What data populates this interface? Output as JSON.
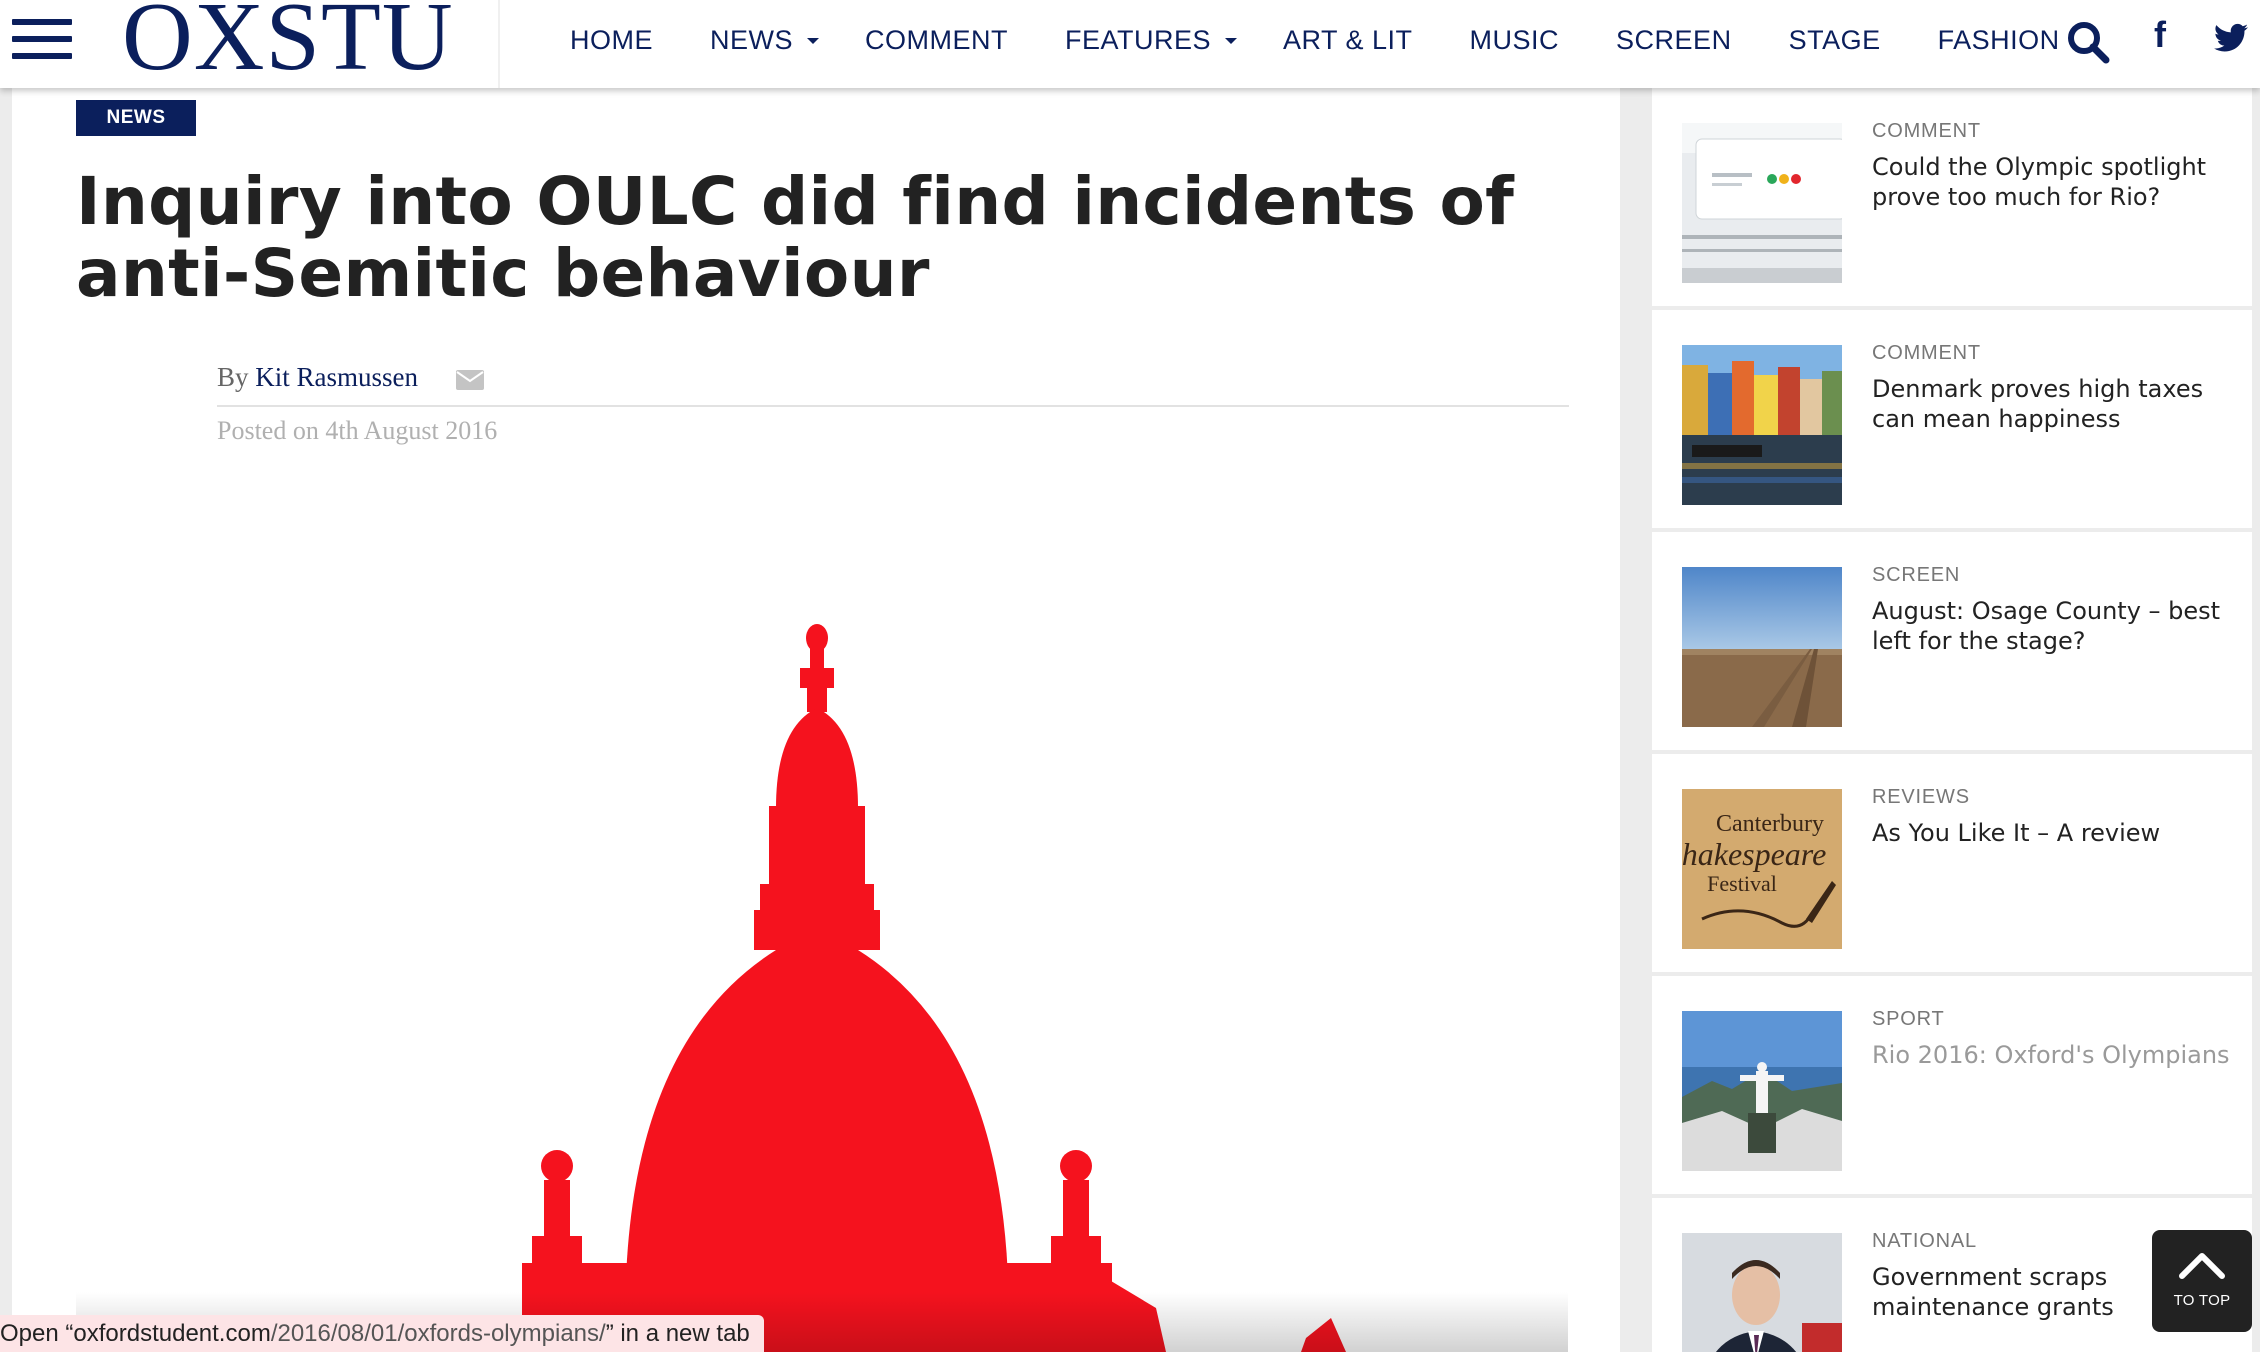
{
  "header": {
    "logo": "OXSTU",
    "nav": [
      {
        "label": "HOME",
        "dropdown": false
      },
      {
        "label": "NEWS",
        "dropdown": true
      },
      {
        "label": "COMMENT",
        "dropdown": false
      },
      {
        "label": "FEATURES",
        "dropdown": true
      },
      {
        "label": "ART & LIT",
        "dropdown": false
      },
      {
        "label": "MUSIC",
        "dropdown": false
      },
      {
        "label": "SCREEN",
        "dropdown": false
      },
      {
        "label": "STAGE",
        "dropdown": false
      },
      {
        "label": "FASHION",
        "dropdown": false
      }
    ],
    "icons": [
      "menu-icon",
      "search-icon",
      "facebook-icon",
      "twitter-icon"
    ]
  },
  "article": {
    "category": "NEWS",
    "title": "Inquiry into OULC did find incidents of anti-Semitic behaviour",
    "byline_prefix": "By",
    "author": "Kit Rasmussen",
    "posted": "Posted on 4th August 2016"
  },
  "sidebar": {
    "items": [
      {
        "category": "COMMENT",
        "title": "Could the Olympic spotlight prove too much for Rio?",
        "thumb": "rio-sign-photo"
      },
      {
        "category": "COMMENT",
        "title": "Denmark proves high taxes can mean happiness",
        "thumb": "nyhavn-photo"
      },
      {
        "category": "SCREEN",
        "title": "August: Osage County – best left for the stage?",
        "thumb": "field-photo"
      },
      {
        "category": "REVIEWS",
        "title": "As You Like It – A review",
        "thumb": "shakespeare-festival-photo"
      },
      {
        "category": "SPORT",
        "title": "Rio 2016: Oxford's Olympians",
        "thumb": "rio-christ-photo"
      },
      {
        "category": "NATIONAL",
        "title": "Government scraps maintenance grants",
        "thumb": "politician-photo"
      }
    ],
    "festival_lines": [
      "Canterbury",
      "Shakespeare",
      "Festival"
    ]
  },
  "status_bar": {
    "prefix": "Open “",
    "domain": "oxfordstudent.com",
    "path": "/2016/08/01/oxfords-olympians/",
    "suffix": "” in a new tab"
  },
  "to_top": {
    "label": "TO TOP"
  },
  "colors": {
    "brand": "#0b1f5c",
    "hero_red": "#f5121e",
    "status_bg": "#fde4e6"
  }
}
